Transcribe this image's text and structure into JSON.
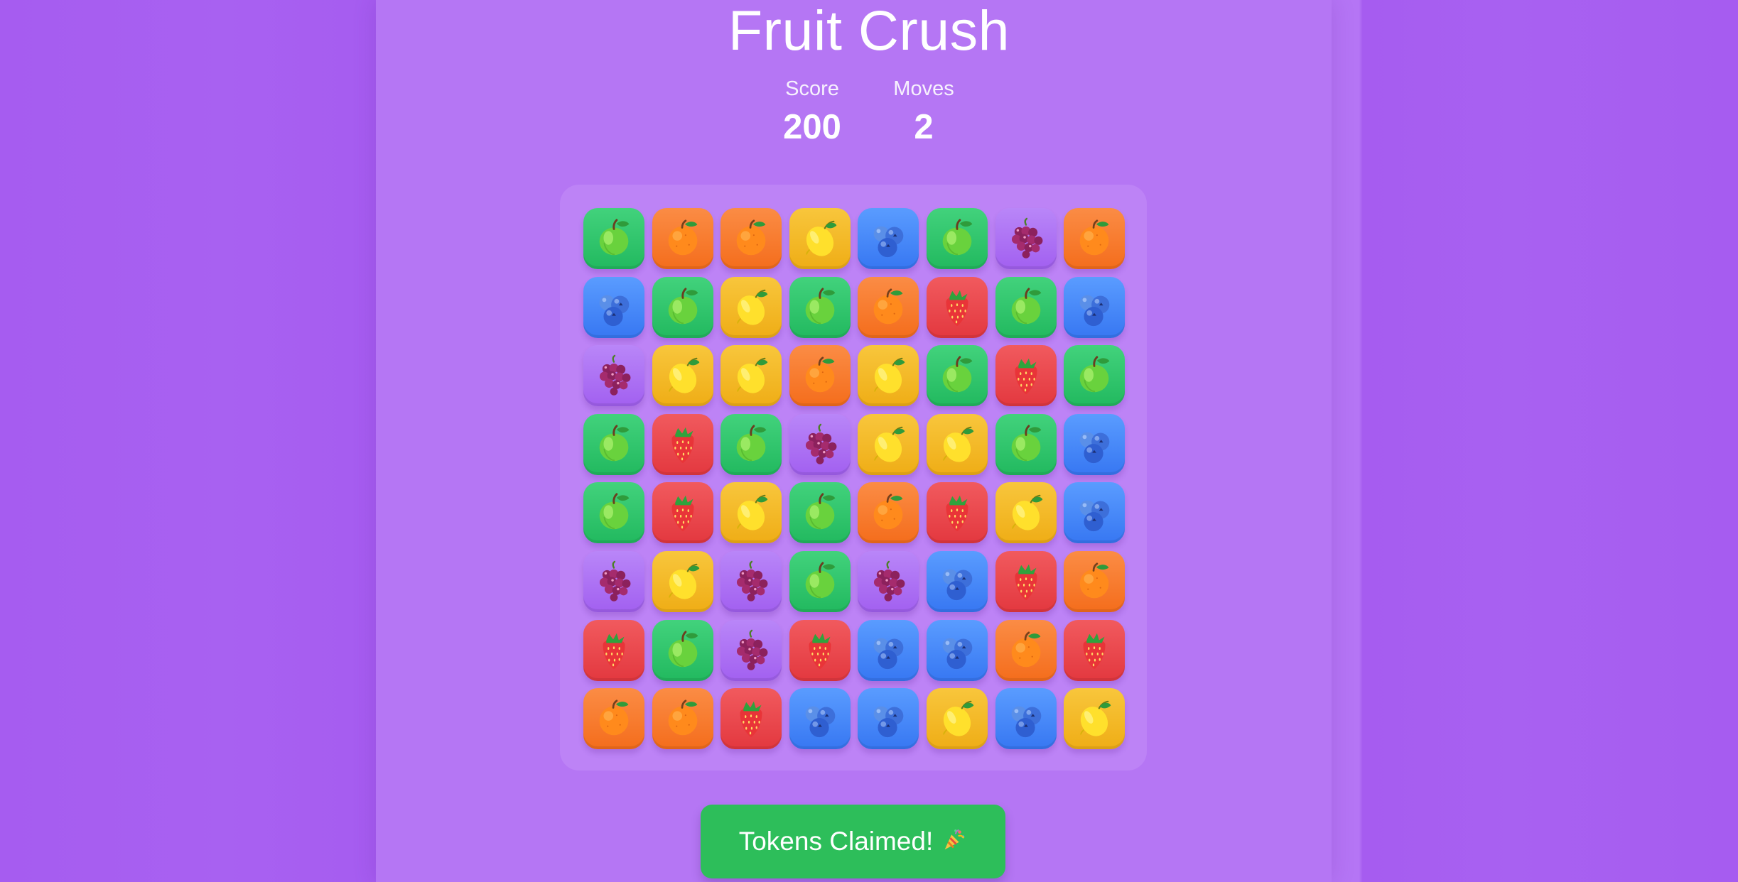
{
  "game": {
    "title": "Fruit Crush",
    "score_label": "Score",
    "score_value": "200",
    "moves_label": "Moves",
    "moves_value": "2",
    "claim_button_label": "Tokens Claimed!"
  },
  "board": {
    "rows": 8,
    "cols": 8,
    "tiles": [
      [
        "apple",
        "orange",
        "orange",
        "lemon",
        "blueberry",
        "apple",
        "grape",
        "orange"
      ],
      [
        "blueberry",
        "apple",
        "lemon",
        "apple",
        "orange",
        "strawberry",
        "apple",
        "blueberry"
      ],
      [
        "grape",
        "lemon",
        "lemon",
        "orange",
        "lemon",
        "apple",
        "strawberry",
        "apple"
      ],
      [
        "apple",
        "strawberry",
        "apple",
        "grape",
        "lemon",
        "lemon",
        "apple",
        "blueberry"
      ],
      [
        "apple",
        "strawberry",
        "lemon",
        "apple",
        "orange",
        "strawberry",
        "lemon",
        "blueberry"
      ],
      [
        "grape",
        "lemon",
        "grape",
        "apple",
        "grape",
        "blueberry",
        "strawberry",
        "orange"
      ],
      [
        "strawberry",
        "apple",
        "grape",
        "strawberry",
        "blueberry",
        "blueberry",
        "orange",
        "strawberry"
      ],
      [
        "orange",
        "orange",
        "strawberry",
        "blueberry",
        "blueberry",
        "lemon",
        "blueberry",
        "lemon"
      ]
    ]
  },
  "icons": {
    "apple": "apple-icon",
    "orange": "orange-icon",
    "lemon": "lemon-icon",
    "blueberry": "blueberry-icon",
    "grape": "grape-icon",
    "strawberry": "strawberry-icon",
    "party": "party-popper-icon"
  },
  "colors": {
    "background": "#a65cf0",
    "panel": "#b576f4",
    "board": "#bd83f6",
    "apple_tile": "#2fc56c",
    "orange_tile": "#f77b2e",
    "lemon_tile": "#f3b82a",
    "blueberry_tile": "#4a8bf7",
    "grape_tile": "#ad72f4",
    "strawberry_tile": "#e9474d",
    "claim_button": "#2dbe5a"
  }
}
